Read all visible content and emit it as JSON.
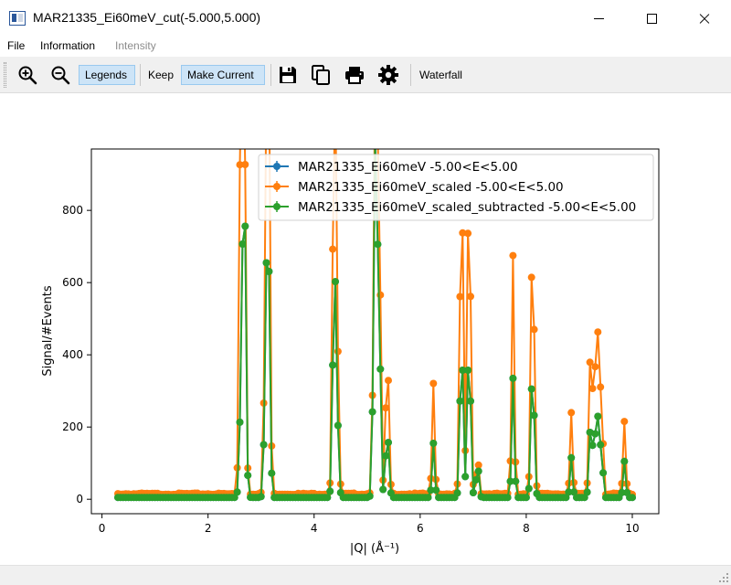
{
  "window": {
    "title": "MAR21335_Ei60meV_cut(-5.000,5.000)"
  },
  "menu": {
    "items": [
      {
        "label": "File",
        "enabled": true
      },
      {
        "label": "Information",
        "enabled": true
      },
      {
        "label": "Intensity",
        "enabled": false
      }
    ]
  },
  "toolbar": {
    "zoom_in_icon": "zoom-in-icon",
    "zoom_out_icon": "zoom-out-icon",
    "legends_label": "Legends",
    "legends_toggled": true,
    "keep_label": "Keep",
    "make_current_label": "Make Current",
    "make_current_toggled": true,
    "save_icon": "save-icon",
    "copy_icon": "copy-icon",
    "print_icon": "print-icon",
    "settings_icon": "gear-icon",
    "waterfall_label": "Waterfall"
  },
  "colors": {
    "series_blue": "#1f77b4",
    "series_orange": "#ff7f0e",
    "series_green": "#2ca02c",
    "toggle_bg": "#cde4f7"
  },
  "chart_data": {
    "type": "line",
    "title": "",
    "xlabel": "|Q| (Å⁻¹)",
    "ylabel": "Signal/#Events",
    "xlim": [
      -0.2,
      10.5
    ],
    "ylim": [
      -40,
      970
    ],
    "xticks": [
      0,
      2,
      4,
      6,
      8,
      10
    ],
    "yticks": [
      0,
      200,
      400,
      600,
      800
    ],
    "grid": false,
    "legend_position": "top-right",
    "peaks": [
      {
        "x": 2.62,
        "w": 0.03,
        "base": 227,
        "scaled": 1100
      },
      {
        "x": 2.68,
        "w": 0.03,
        "base": 930,
        "scaled": 1100
      },
      {
        "x": 3.1,
        "w": 0.03,
        "base": 585,
        "scaled": 1000
      },
      {
        "x": 3.15,
        "w": 0.025,
        "base": 480,
        "scaled": 950
      },
      {
        "x": 4.38,
        "w": 0.03,
        "base": 595,
        "scaled": 1100
      },
      {
        "x": 4.43,
        "w": 0.03,
        "base": 200,
        "scaled": 400
      },
      {
        "x": 5.15,
        "w": 0.03,
        "base": 950,
        "scaled": 1100
      },
      {
        "x": 5.22,
        "w": 0.03,
        "base": 580,
        "scaled": 900
      },
      {
        "x": 5.38,
        "w": 0.03,
        "base": 190,
        "scaled": 390
      },
      {
        "x": 6.25,
        "w": 0.025,
        "base": 150,
        "scaled": 305
      },
      {
        "x": 6.78,
        "w": 0.03,
        "base": 440,
        "scaled": 900
      },
      {
        "x": 6.92,
        "w": 0.03,
        "base": 440,
        "scaled": 900
      },
      {
        "x": 7.08,
        "w": 0.025,
        "base": 100,
        "scaled": 110
      },
      {
        "x": 7.75,
        "w": 0.025,
        "base": 330,
        "scaled": 660
      },
      {
        "x": 8.12,
        "w": 0.03,
        "base": 375,
        "scaled": 750
      },
      {
        "x": 8.85,
        "w": 0.025,
        "base": 110,
        "scaled": 225
      },
      {
        "x": 9.22,
        "w": 0.03,
        "base": 225,
        "scaled": 455
      },
      {
        "x": 9.33,
        "w": 0.03,
        "base": 280,
        "scaled": 560
      },
      {
        "x": 9.42,
        "w": 0.02,
        "base": 210,
        "scaled": 430
      },
      {
        "x": 9.85,
        "w": 0.025,
        "base": 100,
        "scaled": 200
      }
    ],
    "x_range": [
      0.3,
      10.0
    ],
    "x_step": 0.05,
    "background": {
      "base": 5,
      "scaled": 15
    },
    "series": [
      {
        "name": "MAR21335_Ei60meV -5.00<E<5.00",
        "color": "#1f77b4",
        "kind": "base"
      },
      {
        "name": "MAR21335_Ei60meV_scaled -5.00<E<5.00",
        "color": "#ff7f0e",
        "kind": "scaled"
      },
      {
        "name": "MAR21335_Ei60meV_scaled_subtracted -5.00<E<5.00",
        "color": "#2ca02c",
        "kind": "base"
      }
    ]
  }
}
